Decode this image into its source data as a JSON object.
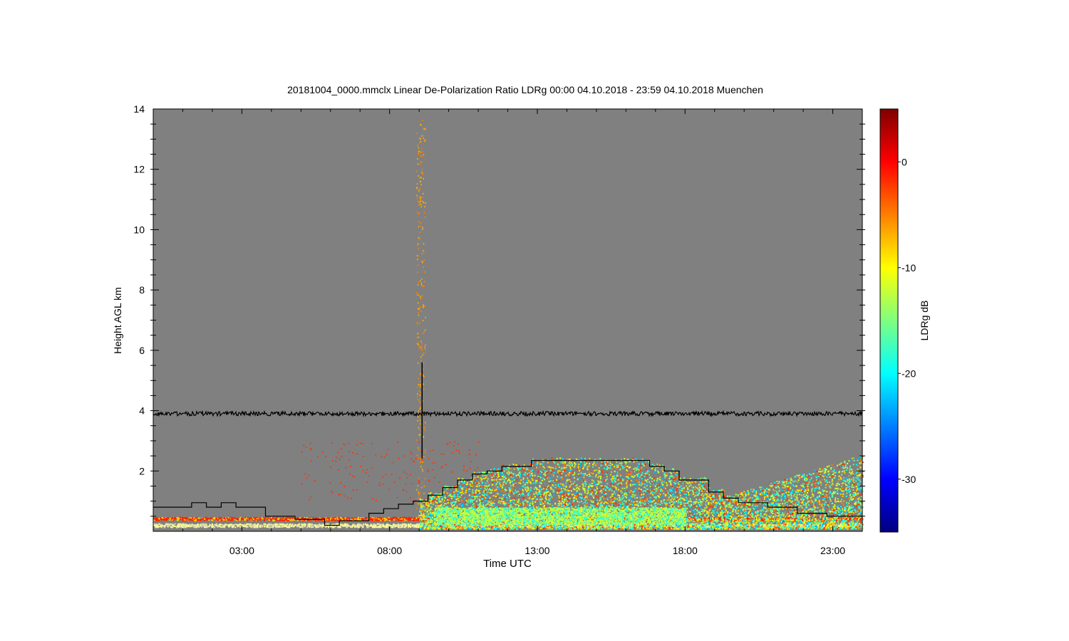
{
  "chart_data": {
    "type": "heatmap",
    "title": "20181004_0000.mmclx Linear De-Polarization Ratio LDRg   00:00 04.10.2018 - 23:59 04.10.2018 Muenchen",
    "xlabel": "Time UTC",
    "ylabel": "Height AGL km",
    "colorbar_label": "LDRg dB",
    "x_unit": "hours UTC",
    "xlim": [
      0,
      24
    ],
    "ylim": [
      0,
      14
    ],
    "x_ticks": [
      {
        "value": 3,
        "label": "03:00"
      },
      {
        "value": 8,
        "label": "08:00"
      },
      {
        "value": 13,
        "label": "13:00"
      },
      {
        "value": 18,
        "label": "18:00"
      },
      {
        "value": 23,
        "label": "23:00"
      }
    ],
    "y_ticks": [
      {
        "value": 2,
        "label": "2"
      },
      {
        "value": 4,
        "label": "4"
      },
      {
        "value": 6,
        "label": "6"
      },
      {
        "value": 8,
        "label": "8"
      },
      {
        "value": 10,
        "label": "10"
      },
      {
        "value": 12,
        "label": "12"
      },
      {
        "value": 14,
        "label": "14"
      }
    ],
    "colorbar_range": [
      -35,
      5
    ],
    "colorbar_ticks": [
      {
        "value": 0,
        "label": "0"
      },
      {
        "value": -10,
        "label": "-10"
      },
      {
        "value": -20,
        "label": "-20"
      },
      {
        "value": -30,
        "label": "-30"
      }
    ],
    "colormap": [
      "#00007f",
      "#0000ff",
      "#007fff",
      "#00ffff",
      "#7fff7f",
      "#ffff00",
      "#ff7f00",
      "#ff0000",
      "#7f0000"
    ],
    "background_color": "#808080",
    "noise_line_height_km": 3.9,
    "spike": {
      "time": 9.1,
      "height_range": [
        2.4,
        5.6
      ]
    },
    "boundary_layer_height": [
      [
        0.0,
        0.8
      ],
      [
        1.3,
        0.8
      ],
      [
        1.3,
        0.95
      ],
      [
        1.8,
        0.95
      ],
      [
        1.8,
        0.8
      ],
      [
        2.3,
        0.8
      ],
      [
        2.3,
        0.95
      ],
      [
        2.8,
        0.95
      ],
      [
        2.8,
        0.8
      ],
      [
        3.8,
        0.8
      ],
      [
        3.8,
        0.5
      ],
      [
        4.8,
        0.5
      ],
      [
        4.8,
        0.4
      ],
      [
        5.8,
        0.4
      ],
      [
        5.8,
        0.2
      ],
      [
        6.3,
        0.2
      ],
      [
        6.3,
        0.35
      ],
      [
        7.3,
        0.35
      ],
      [
        7.3,
        0.6
      ],
      [
        7.8,
        0.6
      ],
      [
        7.8,
        0.75
      ],
      [
        8.3,
        0.75
      ],
      [
        8.3,
        0.9
      ],
      [
        8.8,
        0.9
      ],
      [
        8.8,
        1.0
      ],
      [
        9.3,
        1.0
      ],
      [
        9.3,
        1.2
      ],
      [
        9.8,
        1.2
      ],
      [
        9.8,
        1.45
      ],
      [
        10.3,
        1.45
      ],
      [
        10.3,
        1.7
      ],
      [
        10.8,
        1.7
      ],
      [
        10.8,
        1.9
      ],
      [
        11.3,
        1.9
      ],
      [
        11.3,
        2.0
      ],
      [
        11.8,
        2.0
      ],
      [
        11.8,
        2.15
      ],
      [
        12.8,
        2.15
      ],
      [
        12.8,
        2.35
      ],
      [
        16.8,
        2.35
      ],
      [
        16.8,
        2.15
      ],
      [
        17.3,
        2.15
      ],
      [
        17.3,
        2.0
      ],
      [
        17.8,
        2.0
      ],
      [
        17.8,
        1.7
      ],
      [
        18.8,
        1.7
      ],
      [
        18.8,
        1.3
      ],
      [
        19.3,
        1.3
      ],
      [
        19.3,
        1.1
      ],
      [
        19.8,
        1.1
      ],
      [
        19.8,
        0.95
      ],
      [
        20.8,
        0.95
      ],
      [
        20.8,
        0.8
      ],
      [
        21.8,
        0.8
      ],
      [
        21.8,
        0.6
      ],
      [
        22.8,
        0.6
      ],
      [
        22.8,
        0.5
      ],
      [
        24.0,
        0.5
      ]
    ]
  }
}
